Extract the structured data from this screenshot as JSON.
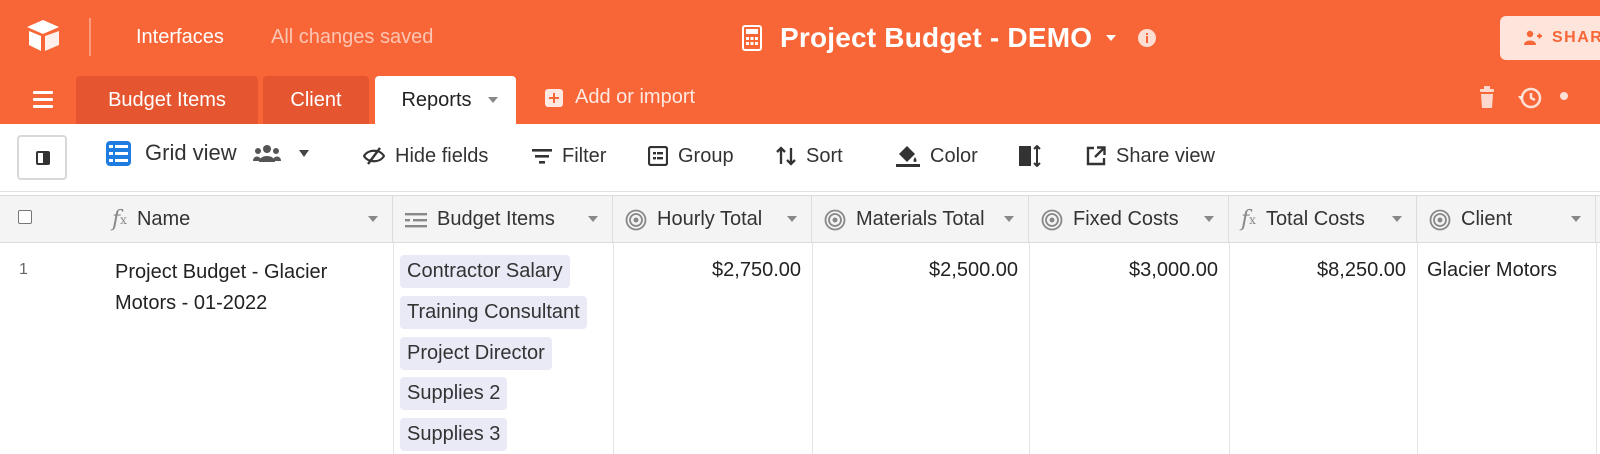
{
  "topbar": {
    "interfaces_label": "Interfaces",
    "saved_status": "All changes saved",
    "base_title": "Project Budget - DEMO",
    "share_label": "SHARE"
  },
  "tabs": [
    {
      "label": "Budget Items",
      "active": false
    },
    {
      "label": "Client",
      "active": false
    },
    {
      "label": "Reports",
      "active": true
    }
  ],
  "add_import_label": "Add or import",
  "viewbar": {
    "view_name": "Grid view",
    "tools": [
      {
        "label": "Hide fields",
        "icon": "hide-fields-icon"
      },
      {
        "label": "Filter",
        "icon": "filter-icon"
      },
      {
        "label": "Group",
        "icon": "group-icon"
      },
      {
        "label": "Sort",
        "icon": "sort-icon"
      },
      {
        "label": "Color",
        "icon": "color-bucket-icon"
      },
      {
        "label": "",
        "icon": "row-height-icon"
      },
      {
        "label": "Share view",
        "icon": "share-view-icon"
      }
    ]
  },
  "columns": [
    {
      "label": "Name",
      "icon": "formula-icon"
    },
    {
      "label": "Budget Items",
      "icon": "linked-record-icon"
    },
    {
      "label": "Hourly Total",
      "icon": "rollup-icon"
    },
    {
      "label": "Materials Total",
      "icon": "rollup-icon"
    },
    {
      "label": "Fixed Costs",
      "icon": "rollup-icon"
    },
    {
      "label": "Total Costs",
      "icon": "formula-icon"
    },
    {
      "label": "Client",
      "icon": "rollup-icon"
    }
  ],
  "rows": [
    {
      "row_number": "1",
      "name": "Project Budget - Glacier Motors - 01-2022",
      "budget_items": [
        "Contractor Salary",
        "Training Consultant",
        "Project Director",
        "Supplies 2",
        "Supplies 3"
      ],
      "hourly_total": "$2,750.00",
      "materials_total": "$2,500.00",
      "fixed_costs": "$3,000.00",
      "total_costs": "$8,250.00",
      "client": "Glacier Motors"
    }
  ],
  "colors": {
    "brand": "#f86637",
    "tab_inactive": "#e55630",
    "chip_bg": "#e9eaf6",
    "grid_view_icon": "#1e7be0"
  }
}
